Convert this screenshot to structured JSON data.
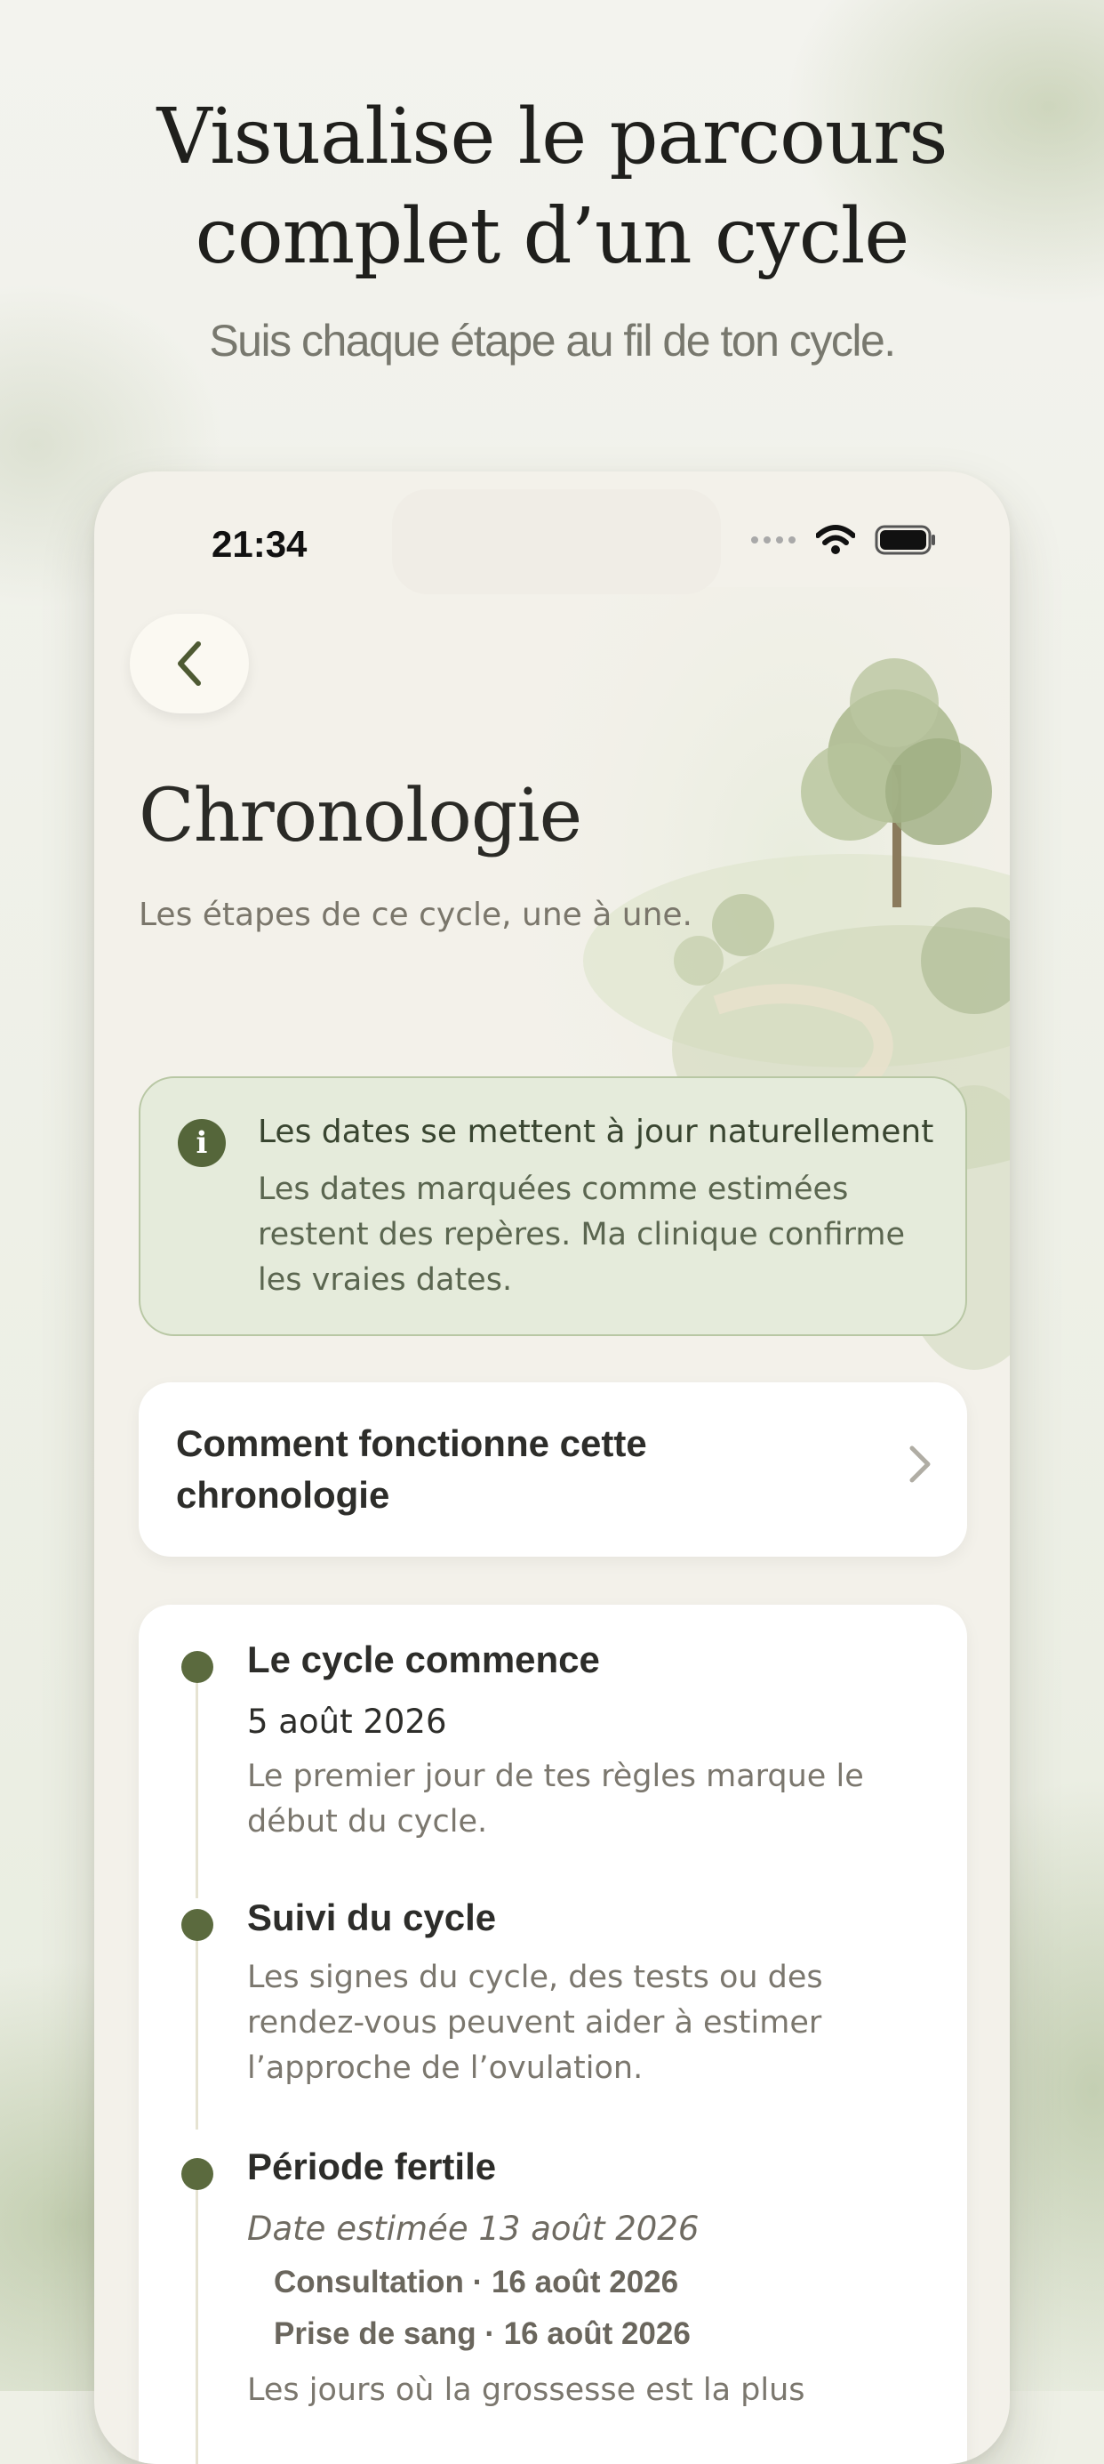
{
  "hero": {
    "title_line1": "Visualise le parcours",
    "title_line2": "complet d’un cycle",
    "subtitle": "Suis chaque étape au fil de ton cycle."
  },
  "status_bar": {
    "time": "21:34",
    "icons": [
      "cellular-dots-icon",
      "wifi-icon",
      "battery-icon"
    ]
  },
  "nav": {
    "back_icon": "chevron-left-icon"
  },
  "page": {
    "title": "Chronologie",
    "subtitle": "Les étapes de ce cycle, une à une."
  },
  "info": {
    "icon": "info-icon",
    "title": "Les dates se mettent à jour naturellement",
    "body": "Les dates marquées comme estimées restent des repères. Ma clinique confirme les vraies dates."
  },
  "how_card": {
    "label": "Comment fonctionne cette chronologie",
    "icon": "chevron-right-icon"
  },
  "timeline": {
    "items": [
      {
        "title": "Le cycle commence",
        "date": "5 août 2026",
        "description": "Le premier jour de tes règles marque le début du cycle."
      },
      {
        "title": "Suivi du cycle",
        "description": "Les signes du cycle, des tests ou des rendez-vous peuvent aider à estimer l’approche de l’ovulation."
      },
      {
        "title": "Période fertile",
        "estimated_date": "Date estimée 13 août 2026",
        "events": [
          "Consultation · 16 août 2026",
          "Prise de sang · 16 août 2026"
        ],
        "description_partial": "Les jours où la grossesse est la plus"
      }
    ]
  },
  "colors": {
    "accent": "#5b6a3e",
    "info_bg": "#e5ebdb",
    "info_border": "#b8c7a4",
    "phone_bg": "#f3f1ea"
  }
}
